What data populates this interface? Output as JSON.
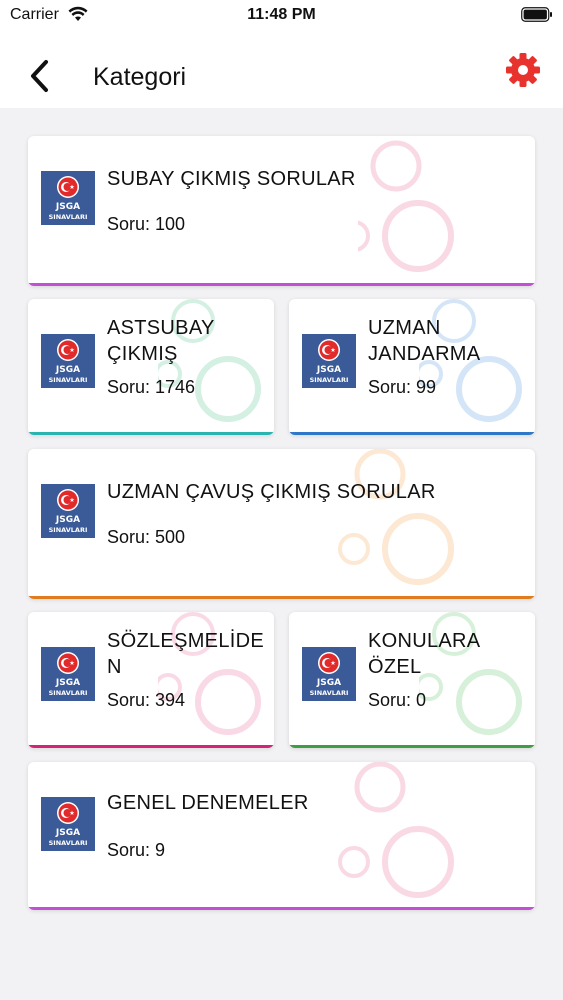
{
  "status_bar": {
    "carrier": "Carrier",
    "time": "11:48 PM"
  },
  "header": {
    "title": "Kategori"
  },
  "logo": {
    "line1": "JSGA",
    "line2": "SINAVLARI"
  },
  "categories": [
    {
      "title": "SUBAY ÇIKMIŞ SORULAR",
      "count": "Soru: 100",
      "color": "#c34fd4"
    },
    {
      "title": "ASTSUBAY ÇIKMIŞ",
      "count": "Soru: 1746",
      "color": "#2bb3b0"
    },
    {
      "title": "UZMAN JANDARMA",
      "count": "Soru: 99",
      "color": "#2f78c7"
    },
    {
      "title": "UZMAN ÇAVUŞ ÇIKMIŞ SORULAR",
      "count": "Soru: 500",
      "color": "#e07b1f"
    },
    {
      "title": "SÖZLEŞMELİDEN",
      "count": "Soru: 394",
      "color": "#d3227a"
    },
    {
      "title": "KONULARA ÖZEL",
      "count": "Soru: 0",
      "color": "#3f9e44"
    },
    {
      "title": "GENEL DENEMELER",
      "count": "Soru: 9",
      "color": "#c34fd4"
    }
  ]
}
